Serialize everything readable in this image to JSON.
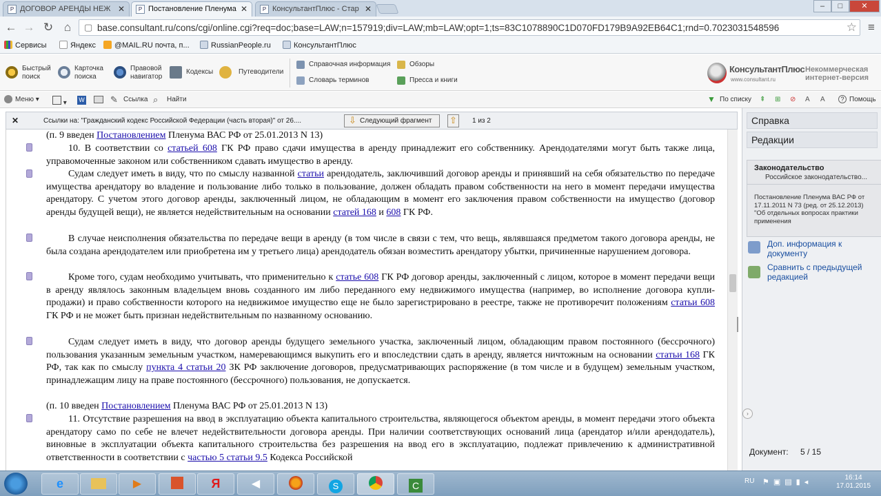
{
  "tabs": [
    {
      "title": "ДОГОВОР АРЕНДЫ НЕЖ",
      "favicon": "P"
    },
    {
      "title": "Постановление Пленума",
      "favicon": "P"
    },
    {
      "title": "КонсультантПлюс - Стар",
      "favicon": "P"
    }
  ],
  "address": {
    "url": "base.consultant.ru/cons/cgi/online.cgi?req=doc;base=LAW;n=157919;div=LAW;mb=LAW;opt=1;ts=83C1078890C1D070FD179B9A92EB64C1;rnd=0.7023031548596"
  },
  "bookmarks": [
    "Сервисы",
    "Яндекс",
    "@MAIL.RU почта, п...",
    "RussianPeople.ru",
    "КонсультантПлюс"
  ],
  "ktoolbar": {
    "quick_search": [
      "Быстрый",
      "поиск"
    ],
    "card_search": [
      "Карточка",
      "поиска"
    ],
    "navigator": [
      "Правовой",
      "навигатор"
    ],
    "codes": "Кодексы",
    "guides": "Путеводители",
    "reference": "Справочная информация",
    "reviews": "Обзоры",
    "dictionary": "Словарь терминов",
    "press": "Пресса и книги",
    "logo": "КонсультантПлюс",
    "logo_url": "www.consultant.ru",
    "noncommercial": [
      "Некоммерческая",
      "интернет-версия"
    ]
  },
  "doctoolbar": {
    "menu": "Меню",
    "link": "Ссылка",
    "find": "Найти",
    "by_list": "По списку",
    "help": "Помощь"
  },
  "linksbar": {
    "label": "Ссылки на: \"Гражданский кодекс Российской Федерации (часть вторая)\" от 26....",
    "next": "Следующий фрагмент",
    "counter": "1 из 2"
  },
  "document": {
    "p0": {
      "pre": "(п. 9 введен ",
      "link": "Постановлением",
      "post": " Пленума ВАС РФ от 25.01.2013 N 13)"
    },
    "p1": {
      "a": "10. В соответствии со ",
      "l1": "статьей 608",
      "b": " ГК РФ право сдачи имущества в аренду принадлежит его собственнику. Арендодателями могут быть также лица, управомоченные законом или собственником сдавать имущество в аренду."
    },
    "p2": {
      "a": "Судам следует иметь в виду, что по смыслу названной ",
      "l1": "статьи",
      "b": " арендодатель, заключивший договор аренды и принявший на себя обязательство по передаче имущества арендатору во владение и пользование либо только в пользование, должен обладать правом собственности на него в момент передачи имущества арендатору. С учетом этого договор аренды, заключенный лицом, не обладающим в момент его заключения правом собственности на имущество (договор аренды будущей вещи), не является недействительным на основании ",
      "l2": "статей 168",
      "c": " и ",
      "l3": "608",
      "d": " ГК РФ."
    },
    "p3": {
      "a": "В случае неисполнения обязательства по передаче вещи в аренду (в том числе в связи с тем, что вещь, являвшаяся предметом такого договора аренды, не была создана арендодателем или приобретена им у третьего лица) арендодатель обязан возместить арендатору убытки, причиненные нарушением договора."
    },
    "p4": {
      "a": "Кроме того, судам необходимо учитывать, что применительно к ",
      "l1": "статье 608",
      "b": " ГК РФ договор аренды, заключенный с лицом, которое в момент передачи вещи в аренду являлось законным владельцем вновь созданного им либо переданного ему недвижимого имущества (например, во исполнение договора купли-продажи) и право собственности которого на недвижимое имущество еще не было зарегистрировано в реестре, также не противоречит положениям ",
      "l2": "статьи 608",
      "c": " ГК РФ и не может быть признан недействительным по названному основанию."
    },
    "p5": {
      "a": "Судам следует иметь в виду, что договор аренды будущего земельного участка, заключенный лицом, обладающим правом постоянного (бессрочного) пользования указанным земельным участком, намеревающимся выкупить его и впоследствии сдать в аренду, является ничтожным на основании ",
      "l1": "статьи 168",
      "b": " ГК РФ, так как по смыслу ",
      "l2": "пункта 4 статьи 20",
      "c": " ЗК РФ заключение договоров, предусматривающих распоряжение (в том числе и в будущем) земельным участком, принадлежащим лицу на праве постоянного (бессрочного) пользования, не допускается."
    },
    "p6": {
      "pre": "(п. 10 введен ",
      "link": "Постановлением",
      "post": " Пленума ВАС РФ от 25.01.2013 N 13)"
    },
    "p7": {
      "a": "11. Отсутствие разрешения на ввод в эксплуатацию объекта капитального строительства, являющегося объектом аренды, в момент передачи этого объекта арендатору само по себе не влечет недействительности договора аренды. При наличии соответствующих оснований лица (арендатор и/или арендодатель), виновные в эксплуатации объекта капитального строительства без разрешения на ввод его в эксплуатацию, подлежат привлечению к административной ответственности в соответствии с ",
      "l1": "частью 5 статьи 9.5",
      "b": " Кодекса Российской"
    }
  },
  "rightpanel": {
    "tab1": "Справка",
    "tab2": "Редакции",
    "card_title": "Законодательство",
    "card_sub": "Российское законодательство...",
    "card_text": "Постановление Пленума ВАС РФ от 17.11.2011 N 73 (ред. от 25.12.2013) \"Об отдельных вопросах практики применения",
    "link1": "Доп. информация к документу",
    "link2": "Сравнить с предыдущей редакцией",
    "doc_label": "Документ:",
    "doc_counter": "5 / 15"
  },
  "taskbar": {
    "lang": "RU",
    "time": "16:14",
    "date": "17.01.2015"
  }
}
